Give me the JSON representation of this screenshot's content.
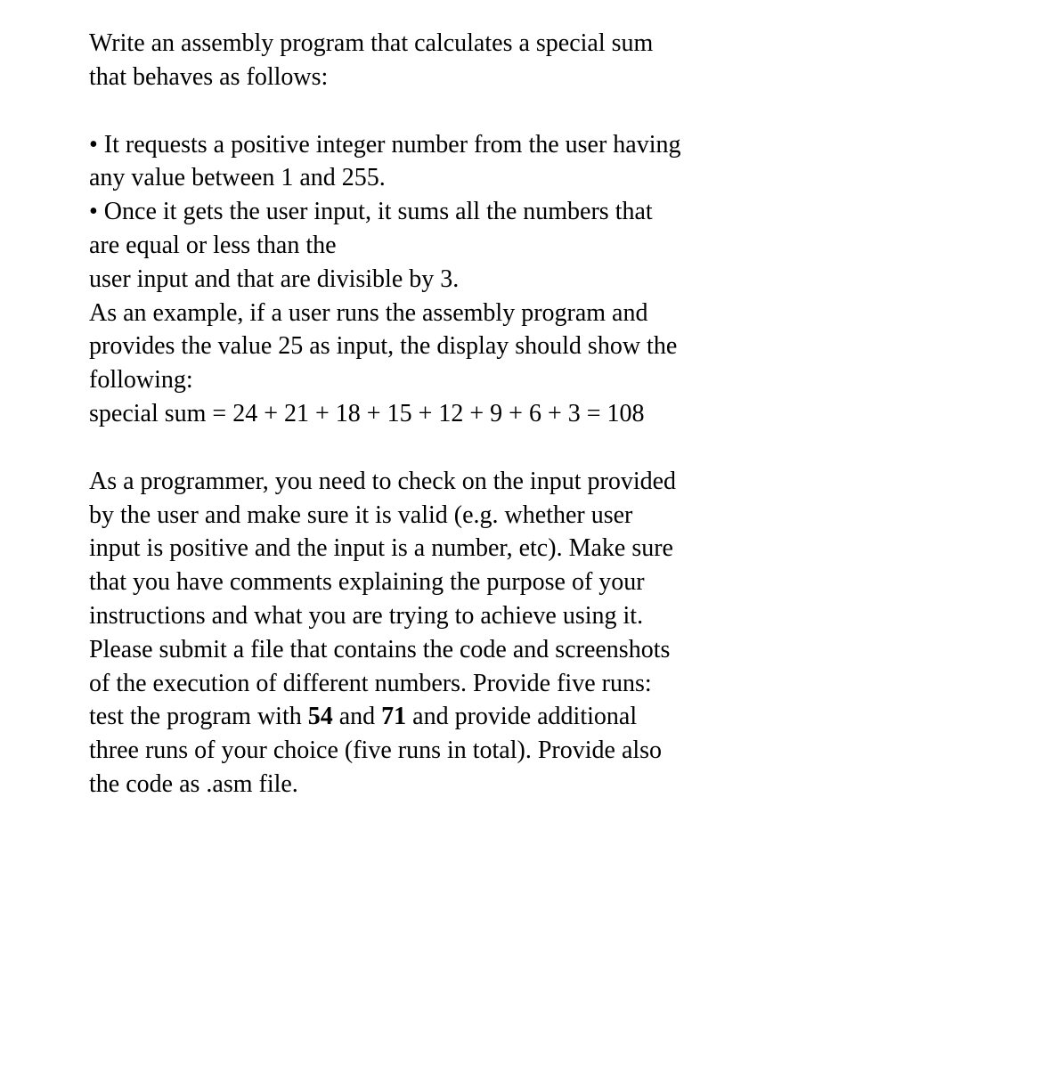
{
  "p1": {
    "line1": "Write an assembly program that calculates a special sum",
    "line2": "that behaves as follows:"
  },
  "p2": {
    "bullet1a": "• It requests a positive integer number from the user having",
    "bullet1b": "any value between 1 and 255.",
    "bullet2a": "• Once it gets the user input, it sums all the numbers that",
    "bullet2b": "are equal or less than the",
    "bullet2c": "user input and that are divisible by 3.",
    "example1": "As an example, if a user runs the assembly program and",
    "example2": "provides the value 25 as input, the display should show the",
    "example3": "following:",
    "formula": "special sum = 24 + 21 + 18 + 15 + 12 + 9 + 6 + 3 = 108"
  },
  "p3": {
    "line1": "As a programmer, you need to check on the input provided",
    "line2": "by the user and make sure it is valid (e.g. whether user",
    "line3": "input is positive and the input is a number, etc). Make sure",
    "line4": "that you have comments explaining the purpose of your",
    "line5": "instructions and what you are trying to achieve using it.",
    "line6": "Please submit a file that contains the code and screenshots",
    "line7": "of the execution of different numbers. Provide five runs:",
    "line8a": "test the program with ",
    "line8b": "54",
    "line8c": " and ",
    "line8d": "71",
    "line8e": " and provide additional",
    "line9": "three runs of your choice (five runs in total).   Provide also",
    "line10": "the code as .asm file."
  }
}
